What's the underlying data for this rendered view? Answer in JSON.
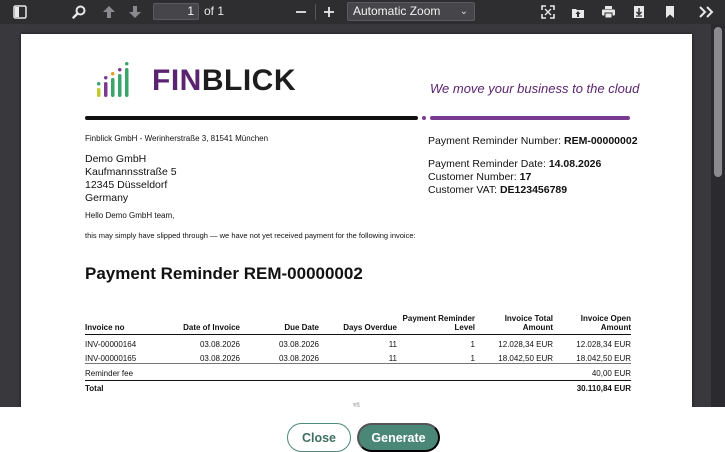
{
  "toolbar": {
    "page_number": "1",
    "page_of": "of 1",
    "zoom": "Automatic Zoom",
    "icons": [
      "sidebar-toggle-icon",
      "search-icon",
      "previous-page-icon",
      "next-page-icon",
      "zoom-out-icon",
      "zoom-in-icon",
      "presentation-mode-icon",
      "open-file-icon",
      "print-icon",
      "download-icon",
      "bookmark-icon",
      "tools-icon"
    ]
  },
  "document": {
    "logo": {
      "part1": "FIN",
      "part2": "BLICK"
    },
    "tagline": "We move your business to the cloud",
    "sender_line": "Finblick GmbH - Werinherstraße 3, 81541 München",
    "recipient": {
      "name": "Demo GmbH",
      "street": "Kaufmannsstraße 5",
      "city": "12345 Düsseldorf",
      "country": "Germany"
    },
    "reminder_number_label": "Payment Reminder Number:",
    "reminder_number": "REM-00000002",
    "reminder_date_label": "Payment Reminder Date:",
    "reminder_date": "14.08.2026",
    "customer_number_label": "Customer Number:",
    "customer_number": "17",
    "customer_vat_label": "Customer VAT:",
    "customer_vat": "DE123456789",
    "greeting": "Hello Demo GmbH team,",
    "intro": "this may simply have slipped through — we have not yet received payment for the following invoice:",
    "title": "Payment Reminder REM-00000002",
    "table": {
      "headers": [
        "Invoice no",
        "Date of Invoice",
        "Due Date",
        "Days Overdue",
        "Payment Reminder Level",
        "Invoice Total Amount",
        "Invoice Open Amount"
      ],
      "rows": [
        [
          "INV-00000164",
          "03.08.2026",
          "03.08.2026",
          "11",
          "1",
          "12.028,34 EUR",
          "12.028,34 EUR"
        ],
        [
          "INV-00000165",
          "03.08.2026",
          "03.08.2026",
          "11",
          "1",
          "18.042,50 EUR",
          "18.042,50 EUR"
        ]
      ],
      "fee_label": "Reminder fee",
      "fee_value": "40,00 EUR",
      "total_label": "Total",
      "total_value": "30.110,84 EUR"
    }
  },
  "footer": {
    "close_label": "Close",
    "generate_label": "Generate"
  },
  "colors": {
    "toolbar_bg": "#2e2e31",
    "viewer_bg": "#38383d",
    "brand_purple": "#5a2470",
    "button_green": "#4a8777"
  }
}
